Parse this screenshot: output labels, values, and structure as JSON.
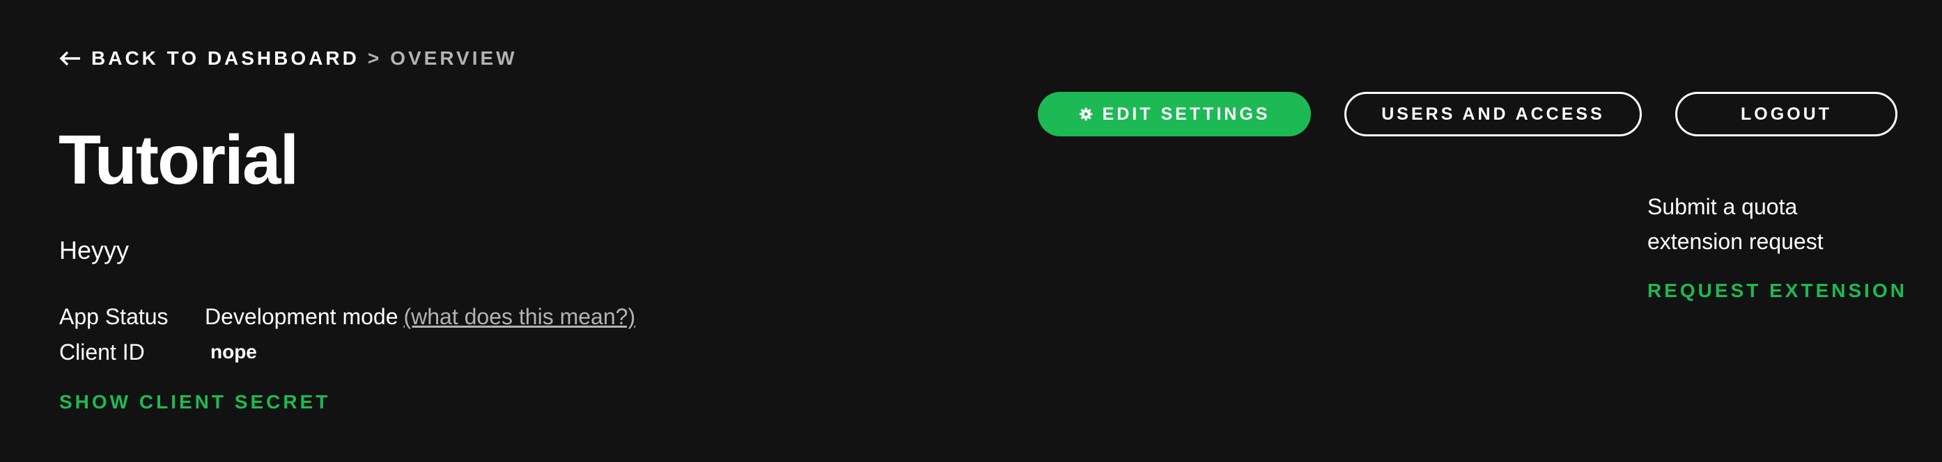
{
  "breadcrumb": {
    "back_label": "BACK TO DASHBOARD",
    "separator": ">",
    "current": "OVERVIEW"
  },
  "app": {
    "title": "Tutorial",
    "description": "Heyyy",
    "status_label": "App Status",
    "status_value": "Development mode",
    "status_help_link": "(what does this mean?)",
    "client_id_label": "Client ID",
    "client_id_value": "nope",
    "show_secret_label": "SHOW CLIENT SECRET"
  },
  "toolbar": {
    "edit_settings_label": "EDIT SETTINGS",
    "users_access_label": "USERS AND ACCESS",
    "logout_label": "LOGOUT"
  },
  "quota": {
    "text": "Submit a quota extension request",
    "request_label": "REQUEST EXTENSION"
  },
  "colors": {
    "background": "#121212",
    "accent": "#1db954",
    "text": "#ffffff",
    "muted": "#b3b3b3"
  },
  "icons": {
    "back": "arrow-left-icon",
    "settings": "gear-icon"
  }
}
